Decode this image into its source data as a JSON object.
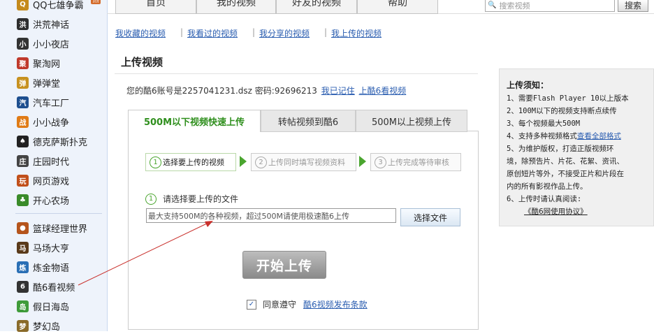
{
  "sidebar": {
    "items": [
      {
        "label": "QQ七雄争霸",
        "icon": "qq-seven-heroes-icon",
        "color": "#c48a1c",
        "glyph": "Q"
      },
      {
        "label": "洪荒神话",
        "icon": "honghuang-icon",
        "color": "#2e2e2e",
        "glyph": "洪"
      },
      {
        "label": "小小夜店",
        "icon": "night-club-icon",
        "color": "#333333",
        "glyph": "小"
      },
      {
        "label": "聚淘网",
        "icon": "jutao-icon",
        "color": "#c0392b",
        "glyph": "聚"
      },
      {
        "label": "弹弹堂",
        "icon": "dandantang-icon",
        "color": "#c7911f",
        "glyph": "弹"
      },
      {
        "label": "汽车工厂",
        "icon": "car-factory-icon",
        "color": "#1e4f8f",
        "glyph": "汽"
      },
      {
        "label": "小小战争",
        "icon": "small-war-icon",
        "color": "#e07b16",
        "glyph": "战"
      },
      {
        "label": "德克萨斯扑克",
        "icon": "poker-icon",
        "color": "#222222",
        "glyph": "♠"
      },
      {
        "label": "庄园时代",
        "icon": "manor-icon",
        "color": "#444444",
        "glyph": "庄"
      },
      {
        "label": "网页游戏",
        "icon": "web-games-icon",
        "color": "#c14f1a",
        "glyph": "玩"
      },
      {
        "label": "开心农场",
        "icon": "happy-farm-icon",
        "color": "#3a8b2a",
        "glyph": "♣"
      },
      {
        "label": "篮球经理世界",
        "icon": "basketball-icon",
        "color": "#b5541c",
        "glyph": "●"
      },
      {
        "label": "马场大亨",
        "icon": "horse-icon",
        "color": "#5a3a1a",
        "glyph": "马"
      },
      {
        "label": "炼金物语",
        "icon": "alchemy-icon",
        "color": "#2a6fb5",
        "glyph": "炼"
      },
      {
        "label": "酷6看视频",
        "icon": "ku6-icon",
        "color": "#333333",
        "glyph": "6"
      },
      {
        "label": "假日海岛",
        "icon": "island-icon",
        "color": "#3f9b3a",
        "glyph": "岛"
      },
      {
        "label": "梦幻岛",
        "icon": "dream-island-icon",
        "color": "#8a6b2a",
        "glyph": "梦"
      }
    ],
    "hot_badge": "热"
  },
  "nav": {
    "tabs": [
      "首页",
      "我的视频",
      "好友的视频",
      "帮助"
    ],
    "search_placeholder": "搜索视频",
    "search_button": "搜索"
  },
  "sublinks": [
    "我收藏的视频",
    "我看过的视频",
    "我分享的视频",
    "我上传的视频"
  ],
  "page_title": "上传视频",
  "account": {
    "text": "您的酷6账号是2257041231.dsz 密码:92696213",
    "remember_link": "我已记住",
    "go_link": "上酷6看视频"
  },
  "upload_tabs": [
    "500M以下视频快速上传",
    "转帖视频到酷6",
    "500M以上视频上传"
  ],
  "steps": [
    {
      "num": "1",
      "label": "选择要上传的视频"
    },
    {
      "num": "2",
      "label": "上传同时填写视频资料"
    },
    {
      "num": "3",
      "label": "上传完成等待审核"
    }
  ],
  "file": {
    "num": "1",
    "label": "请选择要上传的文件",
    "input_value": "最大支持500M的各种视频，超过500M请使用极速酷6上传",
    "choose_button": "选择文件"
  },
  "start_button": "开始上传",
  "agree": {
    "checked": "✓",
    "text": "同意遵守",
    "link": "酷6视频发布条款"
  },
  "notice": {
    "title": "上传须知：",
    "lines": [
      "1、需要Flash Player 10以上版本",
      "2、100M以下的视频支持断点续传",
      "3、每个视频最大500M",
      "4、支持多种视频格式",
      "5、为维护版权，打造正版视频环",
      "境，除预告片、片花、花絮、资讯、",
      "原创短片等外，不接受正片和片段在",
      "内的所有影视作品上传。",
      "6、上传时请认真阅读:"
    ],
    "formats_link": "查看全部格式",
    "agreement_link": "《酷6网使用协议》"
  }
}
